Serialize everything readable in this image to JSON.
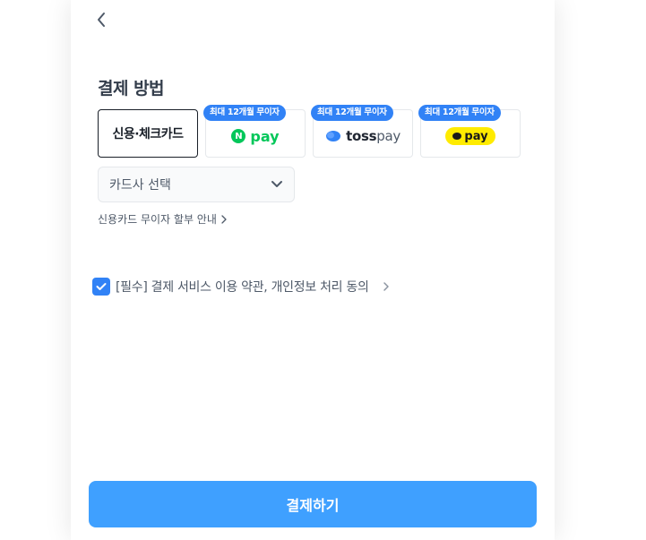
{
  "header": {
    "back_icon": "chevron-left-icon"
  },
  "payment": {
    "title": "결제 방법",
    "methods": [
      {
        "id": "card",
        "label": "신용·체크카드",
        "selected": true,
        "badge": ""
      },
      {
        "id": "npay",
        "label": "pay",
        "logo_mark": "N",
        "badge": "최대 12개월 무이자",
        "brand_color": "#03c75a"
      },
      {
        "id": "tosspay",
        "label_bold": "toss",
        "label_light": "pay",
        "badge": "최대 12개월 무이자",
        "brand_color": "#3182f6"
      },
      {
        "id": "kakaopay",
        "label": "pay",
        "badge": "최대 12개월 무이자",
        "brand_color": "#ffeb00"
      }
    ],
    "card_select": {
      "value": "카드사 선택",
      "icon": "chevron-down-icon"
    },
    "installment_link": "신용카드 무이자 할부 안내"
  },
  "agreement": {
    "checked": true,
    "label": "[필수] 결제 서비스 이용 약관, 개인정보 처리 동의"
  },
  "submit": {
    "label": "결제하기"
  },
  "colors": {
    "accent": "#3182f6",
    "button": "#3fa0ff"
  }
}
